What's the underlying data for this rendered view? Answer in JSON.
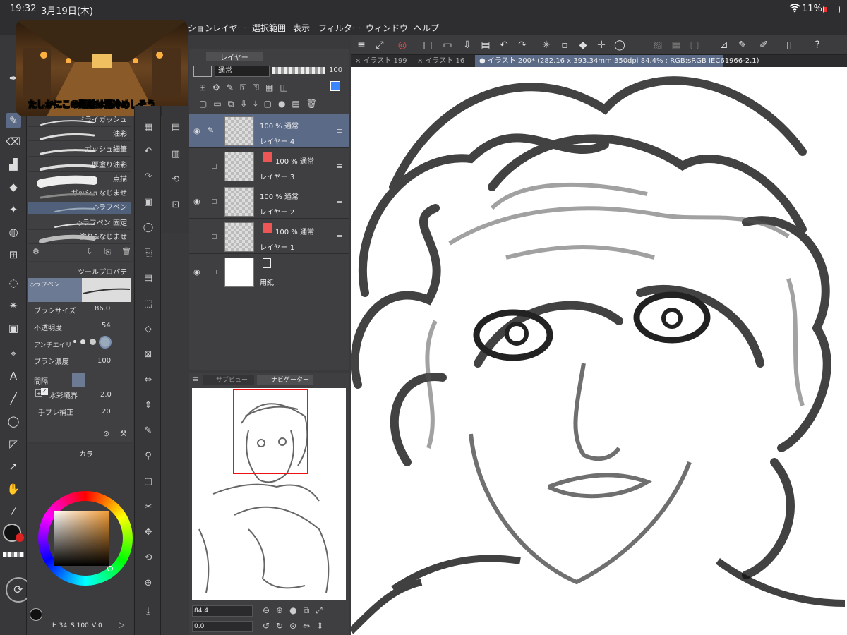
{
  "status": {
    "time": "19:32",
    "date": "3月19日(木)",
    "battery": "11%"
  },
  "menu": {
    "items": [
      "ション",
      "レイヤー",
      "選択範囲",
      "表示",
      "フィルター",
      "ウィンドウ",
      "ヘルプ"
    ]
  },
  "video": {
    "caption": "たしかにこの距離は湯冷めしそう"
  },
  "tabs": [
    {
      "label": "イラスト 199"
    },
    {
      "label": "イラスト 16"
    },
    {
      "label": "イラスト 200* (282.16 x 393.34mm 350dpi 84.4% : RGB:sRGB IEC61966-2.1)"
    }
  ],
  "subtool": {
    "brushes": [
      "ドライガッシュ",
      "油彩",
      "ガッシュ細筆",
      "厚塗り油彩",
      "点描",
      "ガッシュなじませ",
      "◇ラフペン",
      "◇ラフペン 固定",
      "塗り&なじませ"
    ],
    "selected": "◇ラフペン"
  },
  "toolprop": {
    "tab": "ツールプロパティ",
    "current": "◇ラフペン",
    "brush_size_label": "ブラシサイズ",
    "brush_size": "86.0",
    "opacity_label": "不透明度",
    "opacity": "54",
    "aa_label": "アンチエイリ",
    "density_label": "ブラシ濃度",
    "density": "100",
    "interval_label": "間隔",
    "watercolor_label": "水彩境界",
    "watercolor": "2.0",
    "stabilize_label": "手ブレ補正",
    "stabilize": "20"
  },
  "color": {
    "tab": "カラ",
    "footer_h": "H",
    "footer_h_val": "34",
    "footer_s": "S",
    "footer_s_val": "100",
    "footer_v": "V",
    "footer_v_val": "0"
  },
  "layers": {
    "title": "レイヤー",
    "blend": "通常",
    "opacity_value": "100",
    "items": [
      {
        "mode": "100 % 通常",
        "name": "レイヤー 4"
      },
      {
        "mode": "100 % 通常",
        "name": "レイヤー 3"
      },
      {
        "mode": "100 % 通常",
        "name": "レイヤー 2"
      },
      {
        "mode": "100 % 通常",
        "name": "レイヤー 1"
      },
      {
        "mode": "",
        "name": "用紙"
      }
    ]
  },
  "navigator": {
    "tab_sub": "サブビュー",
    "tab_nav": "ナビゲーター",
    "zoom": "84.4",
    "rotate": "0.0"
  }
}
